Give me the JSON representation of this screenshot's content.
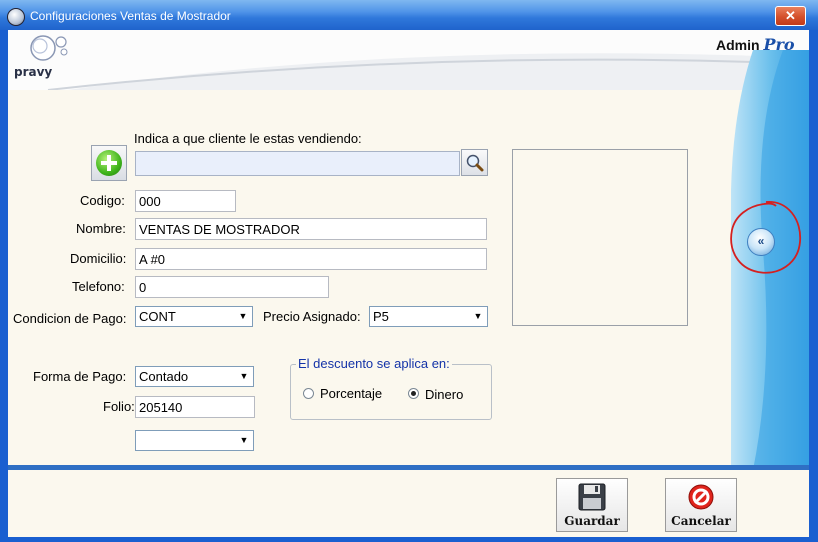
{
  "window": {
    "title": "Configuraciones Ventas de Mostrador",
    "close_label": "✕"
  },
  "header": {
    "logo_text": "pravy",
    "brand_admin": "Admin",
    "brand_pro": "Pro"
  },
  "form": {
    "client_prompt": "Indica a que cliente le estas vendiendo:",
    "client_search_value": "",
    "codigo_label": "Codigo:",
    "codigo_value": "000",
    "nombre_label": "Nombre:",
    "nombre_value": "VENTAS DE MOSTRADOR",
    "domicilio_label": "Domicilio:",
    "domicilio_value": "A #0",
    "telefono_label": "Telefono:",
    "telefono_value": "0",
    "condicion_label": "Condicion de Pago:",
    "condicion_value": "CONT",
    "precio_label": "Precio Asignado:",
    "precio_value": "P5",
    "forma_label": "Forma de Pago:",
    "forma_value": "Contado",
    "folio_label": "Folio:",
    "folio_value": "205140",
    "extra_select_value": ""
  },
  "discount": {
    "legend": "El descuento se aplica en:",
    "options": [
      {
        "label": "Porcentaje",
        "selected": false
      },
      {
        "label": "Dinero",
        "selected": true
      }
    ]
  },
  "buttons": {
    "collapse_label": "«",
    "save_label": "Guardar",
    "cancel_label": "Cancelar"
  },
  "colors": {
    "title_bar": "#2f78db",
    "client_bg": "#fbf8ee",
    "accent_blue": "#2f6fc4",
    "annotation_red": "#d42020"
  }
}
